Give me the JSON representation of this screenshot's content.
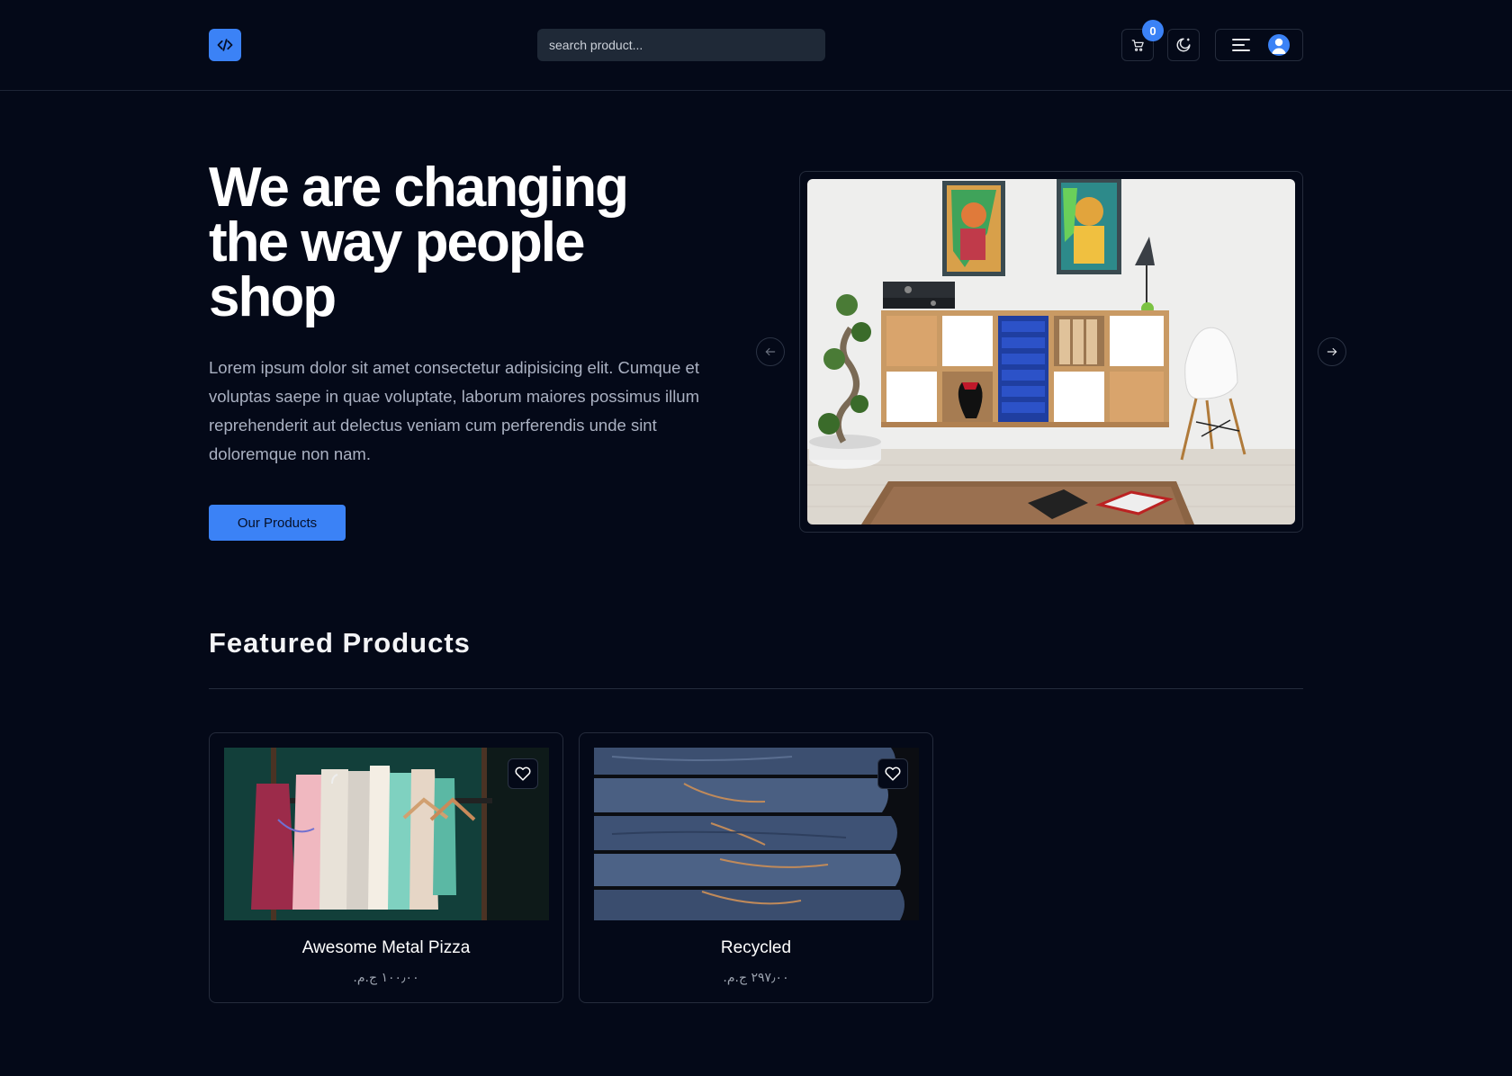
{
  "header": {
    "logo_icon": "code-icon",
    "search_placeholder": "search product...",
    "cart_icon": "cart-icon",
    "cart_count": "0",
    "theme_icon": "moon-icon",
    "menu_icon": "hamburger-icon",
    "avatar_icon": "user-avatar-icon"
  },
  "hero": {
    "title": "We are changing the way people shop",
    "description": "Lorem ipsum dolor sit amet consectetur adipisicing elit. Cumque et voluptas saepe in quae voluptate, laborum maiores possimus illum reprehenderit aut delectus veniam cum perferendis unde sint doloremque non nam.",
    "cta_label": "Our Products"
  },
  "carousel": {
    "image": "living-room-furniture-photo",
    "prev_icon": "arrow-left-icon",
    "next_icon": "arrow-right-icon"
  },
  "featured": {
    "title": "Featured Products",
    "products": [
      {
        "name": "Awesome Metal Pizza",
        "price": "١٠٠٫٠٠ ج.م.‏",
        "image": "clothing-rack-photo"
      },
      {
        "name": "Recycled",
        "price": "٢٩٧٫٠٠ ج.م.‏",
        "image": "folded-jeans-photo"
      }
    ]
  },
  "colors": {
    "background": "#040918",
    "accent": "#3b82f6",
    "border": "#252c3c"
  }
}
